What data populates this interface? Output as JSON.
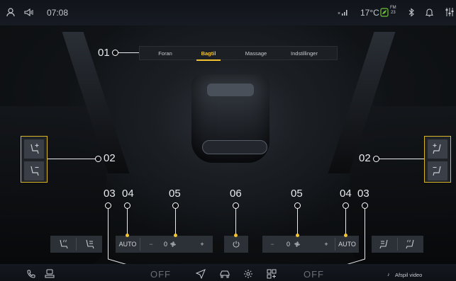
{
  "status_bar": {
    "time": "07:08",
    "temperature": "17°C",
    "fm_label": "FM",
    "fm_channel": "23"
  },
  "tabs": [
    {
      "label": "Foran",
      "active": false
    },
    {
      "label": "Bagtil",
      "active": true
    },
    {
      "label": "Massage",
      "active": false
    },
    {
      "label": "Indstillinger",
      "active": false
    }
  ],
  "callouts": {
    "c01": "01",
    "c02_left": "02",
    "c02_right": "02",
    "c03_left": "03",
    "c04_left": "04",
    "c05_left": "05",
    "c06": "06",
    "c05_right": "05",
    "c04_right": "04",
    "c03_right": "03"
  },
  "controls": {
    "left_auto": "AUTO",
    "left_minus": "−",
    "left_fan_value": "0",
    "left_plus": "+",
    "right_minus": "−",
    "right_fan_value": "0",
    "right_plus": "+",
    "right_auto": "AUTO"
  },
  "dock": {
    "left_off": "OFF",
    "right_off": "OFF",
    "play_video": "Afspil video"
  },
  "colors": {
    "accent": "#f2c230",
    "panel": "#2c3037",
    "background": "#0b0d10"
  },
  "icons": [
    "user-icon",
    "volume-icon",
    "signal-icon",
    "eco-icon",
    "bluetooth-icon",
    "bell-icon",
    "settings-sliders-icon",
    "seat-recline-forward-icon",
    "seat-recline-back-icon",
    "seat-heat-icon",
    "seat-ventilation-icon",
    "fan-icon",
    "power-icon",
    "phone-icon",
    "car-link-icon",
    "navigation-icon",
    "car-icon",
    "gear-icon",
    "apps-icon",
    "music-note-icon"
  ]
}
